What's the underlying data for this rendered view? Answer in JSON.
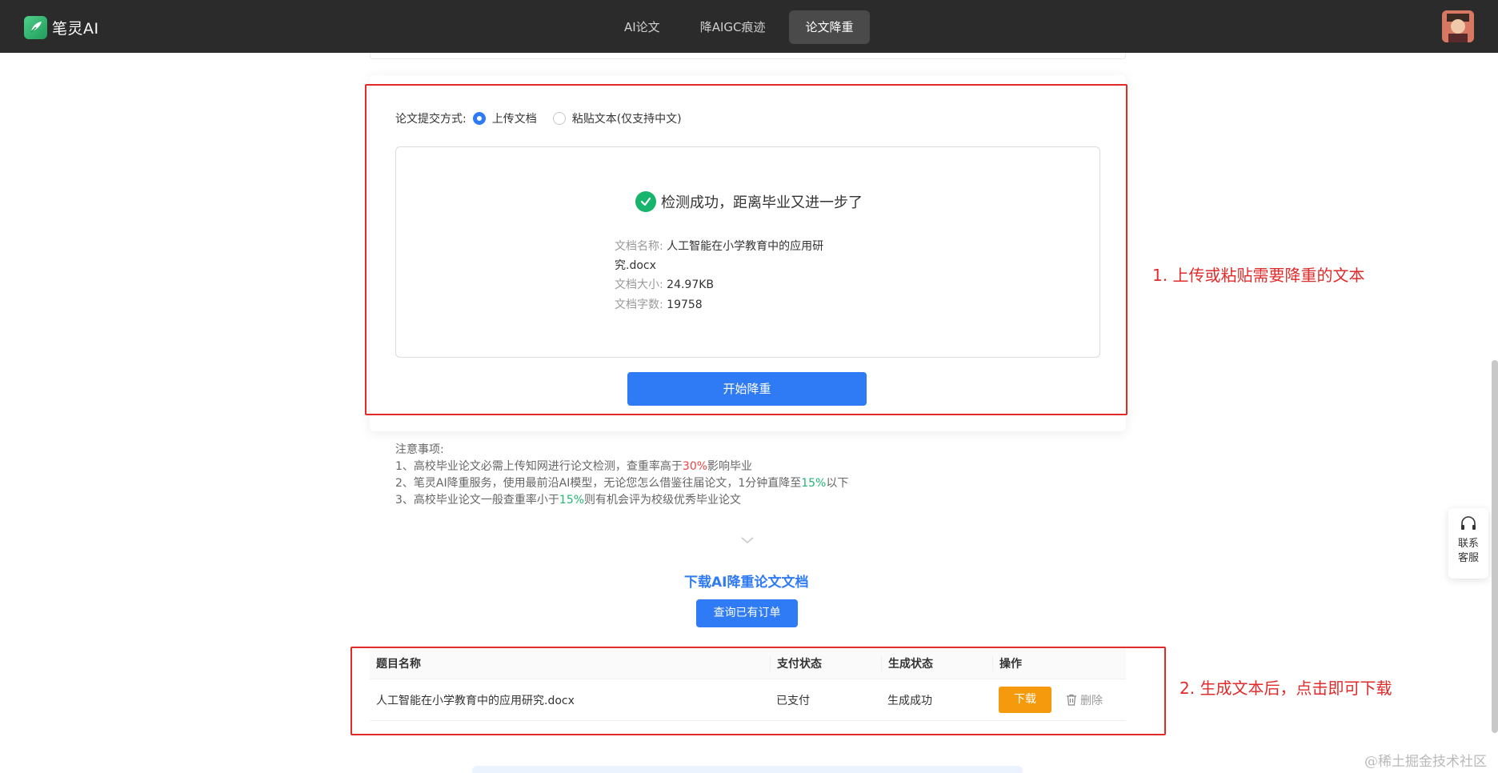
{
  "header": {
    "brand": "笔灵AI",
    "nav": [
      "AI论文",
      "降AIGC痕迹",
      "论文降重"
    ],
    "active_nav": "论文降重"
  },
  "submit": {
    "label": "论文提交方式:",
    "options": [
      "上传文档",
      "粘贴文本(仅支持中文)"
    ],
    "selected": "上传文档"
  },
  "result": {
    "success": "检测成功，距离毕业又进一步了",
    "doc_name_key": "文档名称:",
    "doc_name_line1": "人工智能在小学教育中的应用研",
    "doc_name_line2": "究.docx",
    "doc_size_key": "文档大小:",
    "doc_size": "24.97KB",
    "doc_words_key": "文档字数:",
    "doc_words": "19758"
  },
  "start_button": "开始降重",
  "notes": {
    "title": "注意事项:",
    "n1_a": "1、高校毕业论文必需上传知网进行论文检测，查重率高于",
    "n1_b": "30%",
    "n1_c": "影响毕业",
    "n2_a": "2、笔灵AI降重服务，使用最前沿AI模型，无论您怎么借鉴往届论文，1分钟直降至",
    "n2_b": "15%",
    "n2_c": "以下",
    "n3_a": "3、高校毕业论文一般查重率小于",
    "n3_b": "15%",
    "n3_c": "则有机会评为校级优秀毕业论文"
  },
  "download": {
    "title": "下载AI降重论文文档",
    "query_button": "查询已有订单"
  },
  "table": {
    "headers": [
      "题目名称",
      "支付状态",
      "生成状态",
      "操作"
    ],
    "rows": [
      {
        "name": "人工智能在小学教育中的应用研究.docx",
        "pay": "已支付",
        "status": "生成成功",
        "download": "下载",
        "delete": "删除"
      }
    ]
  },
  "annotations": {
    "a1": "1. 上传或粘贴需要降重的文本",
    "a2": "2. 生成文本后，点击即可下载"
  },
  "service": {
    "line1": "联系",
    "line2": "客服"
  },
  "watermark": "@稀土掘金技术社区",
  "colors": {
    "primary": "#2f7bf5",
    "success": "#17b46c",
    "download": "#f59a0c",
    "annotation": "#e02b2b"
  }
}
